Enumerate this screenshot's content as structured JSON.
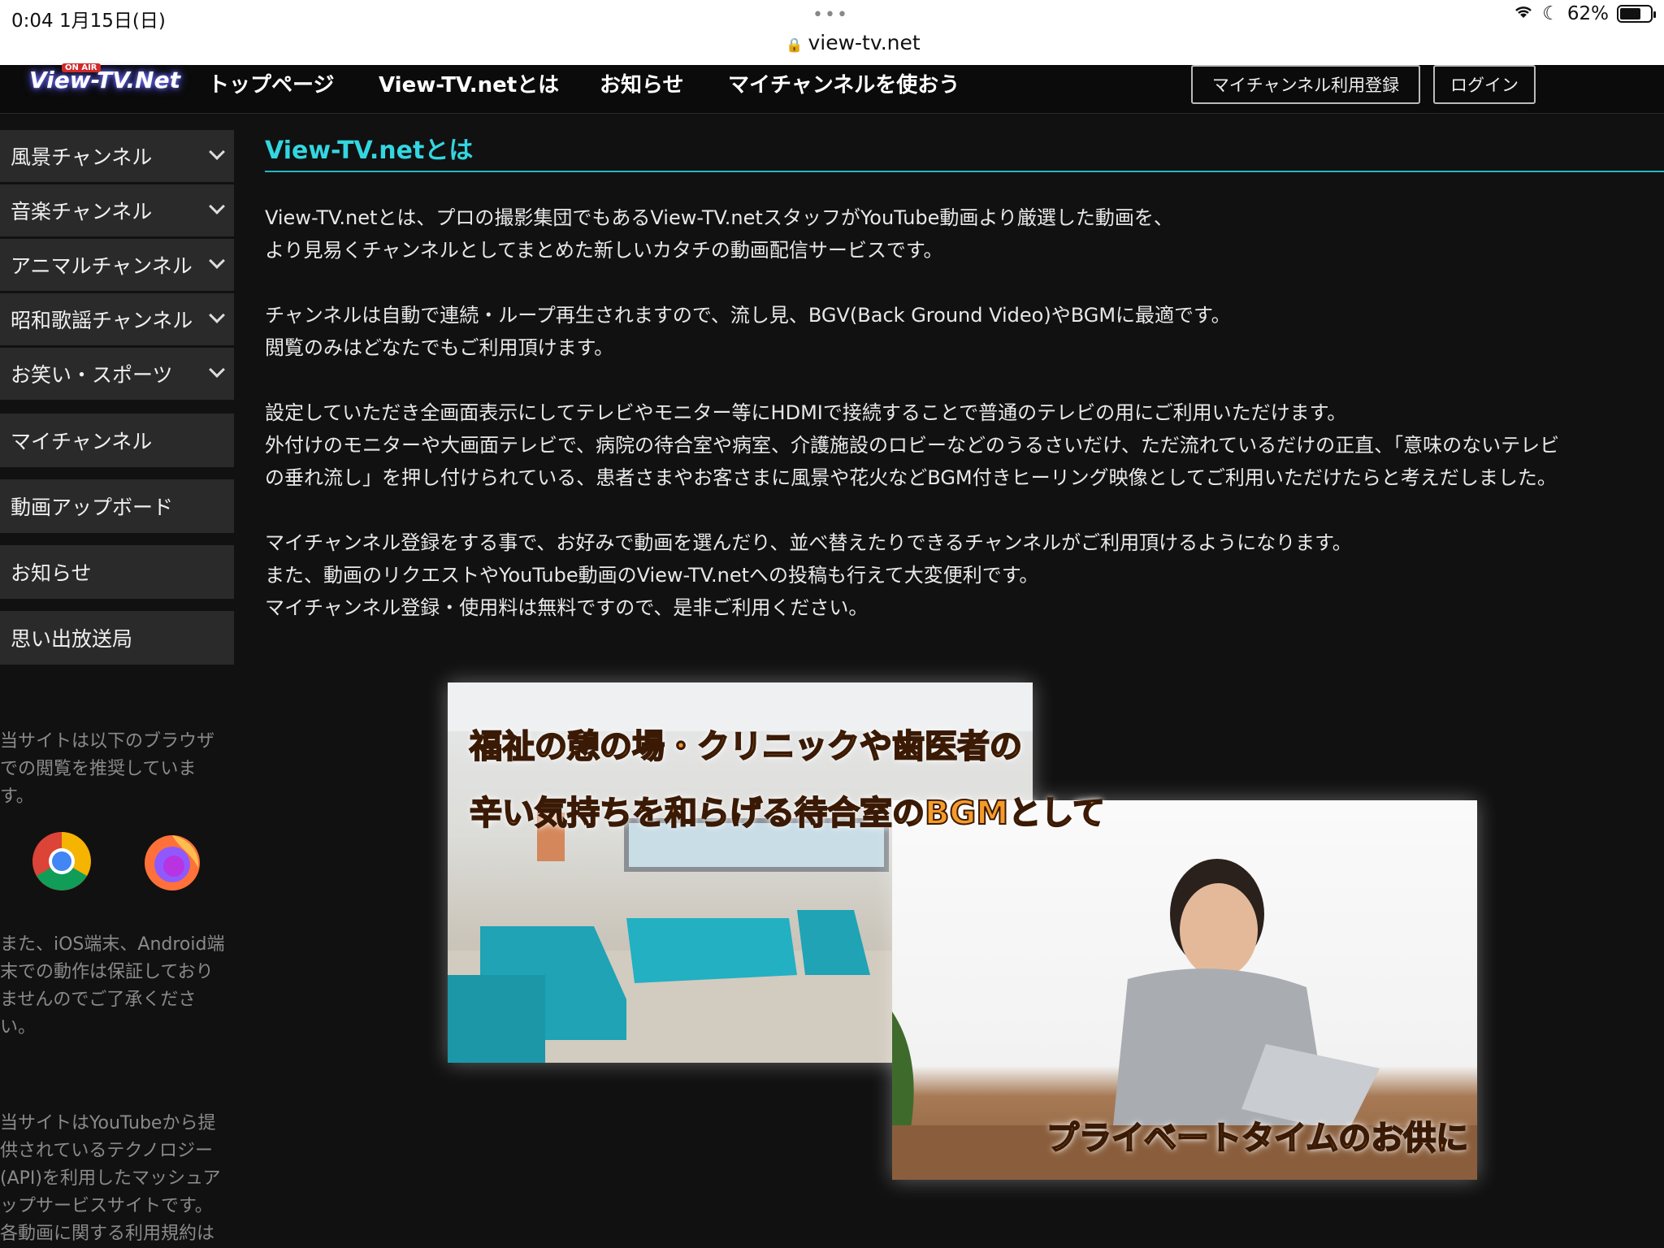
{
  "status_bar": {
    "time": "0:04  1月15日(日)",
    "dots": "•••",
    "url": "view-tv.net",
    "battery": "62%"
  },
  "header": {
    "logo": "View-TV.Net",
    "logo_badge": "ON AIR",
    "nav": [
      "トップページ",
      "View-TV.netとは",
      "お知らせ",
      "マイチャンネルを使おう"
    ],
    "register_button": "マイチャンネル利用登録",
    "login_button": "ログイン"
  },
  "sidebar": {
    "categories": [
      "風景チャンネル",
      "音楽チャンネル",
      "アニマルチャンネル",
      "昭和歌謡チャンネル",
      "お笑い・スポーツ"
    ],
    "items": [
      "マイチャンネル",
      "動画アップボード",
      "お知らせ",
      "思い出放送局"
    ],
    "browser_note": [
      "当サイトは以下のブラウザ",
      "での閲覧を推奨していま",
      "す。"
    ],
    "device_note": [
      "また、iOS端末、Android端",
      "末での動作は保証しており",
      "ませんのでご了承くださ",
      "い。"
    ],
    "api_note": [
      "当サイトはYouTubeから提",
      "供されているテクノロジー",
      "(API)を利用したマッシュア",
      "ップサービスサイトです。",
      "各動画に関する利用規約は"
    ]
  },
  "main": {
    "title": "View-TV.netとは",
    "paragraphs": [
      [
        "View-TV.netとは、プロの撮影集団でもあるView-TV.netスタッフがYouTube動画より厳選した動画を、",
        "より見易くチャンネルとしてまとめた新しいカタチの動画配信サービスです。"
      ],
      [
        "チャンネルは自動で連続・ループ再生されますので、流し見、BGV(Back Ground Video)やBGMに最適です。",
        "閲覧のみはどなたでもご利用頂けます。"
      ],
      [
        "設定していただき全画面表示にしてテレビやモニター等にHDMIで接続することで普通のテレビの用にご利用いただけます。",
        "外付けのモニターや大画面テレビで、病院の待合室や病室、介護施設のロビーなどのうるさいだけ、ただ流れているだけの正直、「意味のないテレビ",
        "の垂れ流し」を押し付けられている、患者さまやお客さまに風景や花火などBGM付きヒーリング映像としてご利用いただけたらと考えだしました。"
      ],
      [
        "マイチャンネル登録をする事で、お好みで動画を選んだり、並べ替えたりできるチャンネルがご利用頂けるようになります。",
        "また、動画のリクエストやYouTube動画のView-TV.netへの投稿も行えて大変便利です。",
        "マイチャンネル登録・使用料は無料ですので、是非ご利用ください。"
      ]
    ],
    "image_caption_1": "福祉の憩の場・クリニックや歯医者の",
    "image_caption_2": "辛い気持ちを和らげる待合室のBGMとして",
    "image_caption_3": "プライベートタイムのお供に"
  },
  "colors": {
    "accent": "#33d6e0",
    "background": "#111111",
    "sidebar_item": "#2a2a2a"
  }
}
